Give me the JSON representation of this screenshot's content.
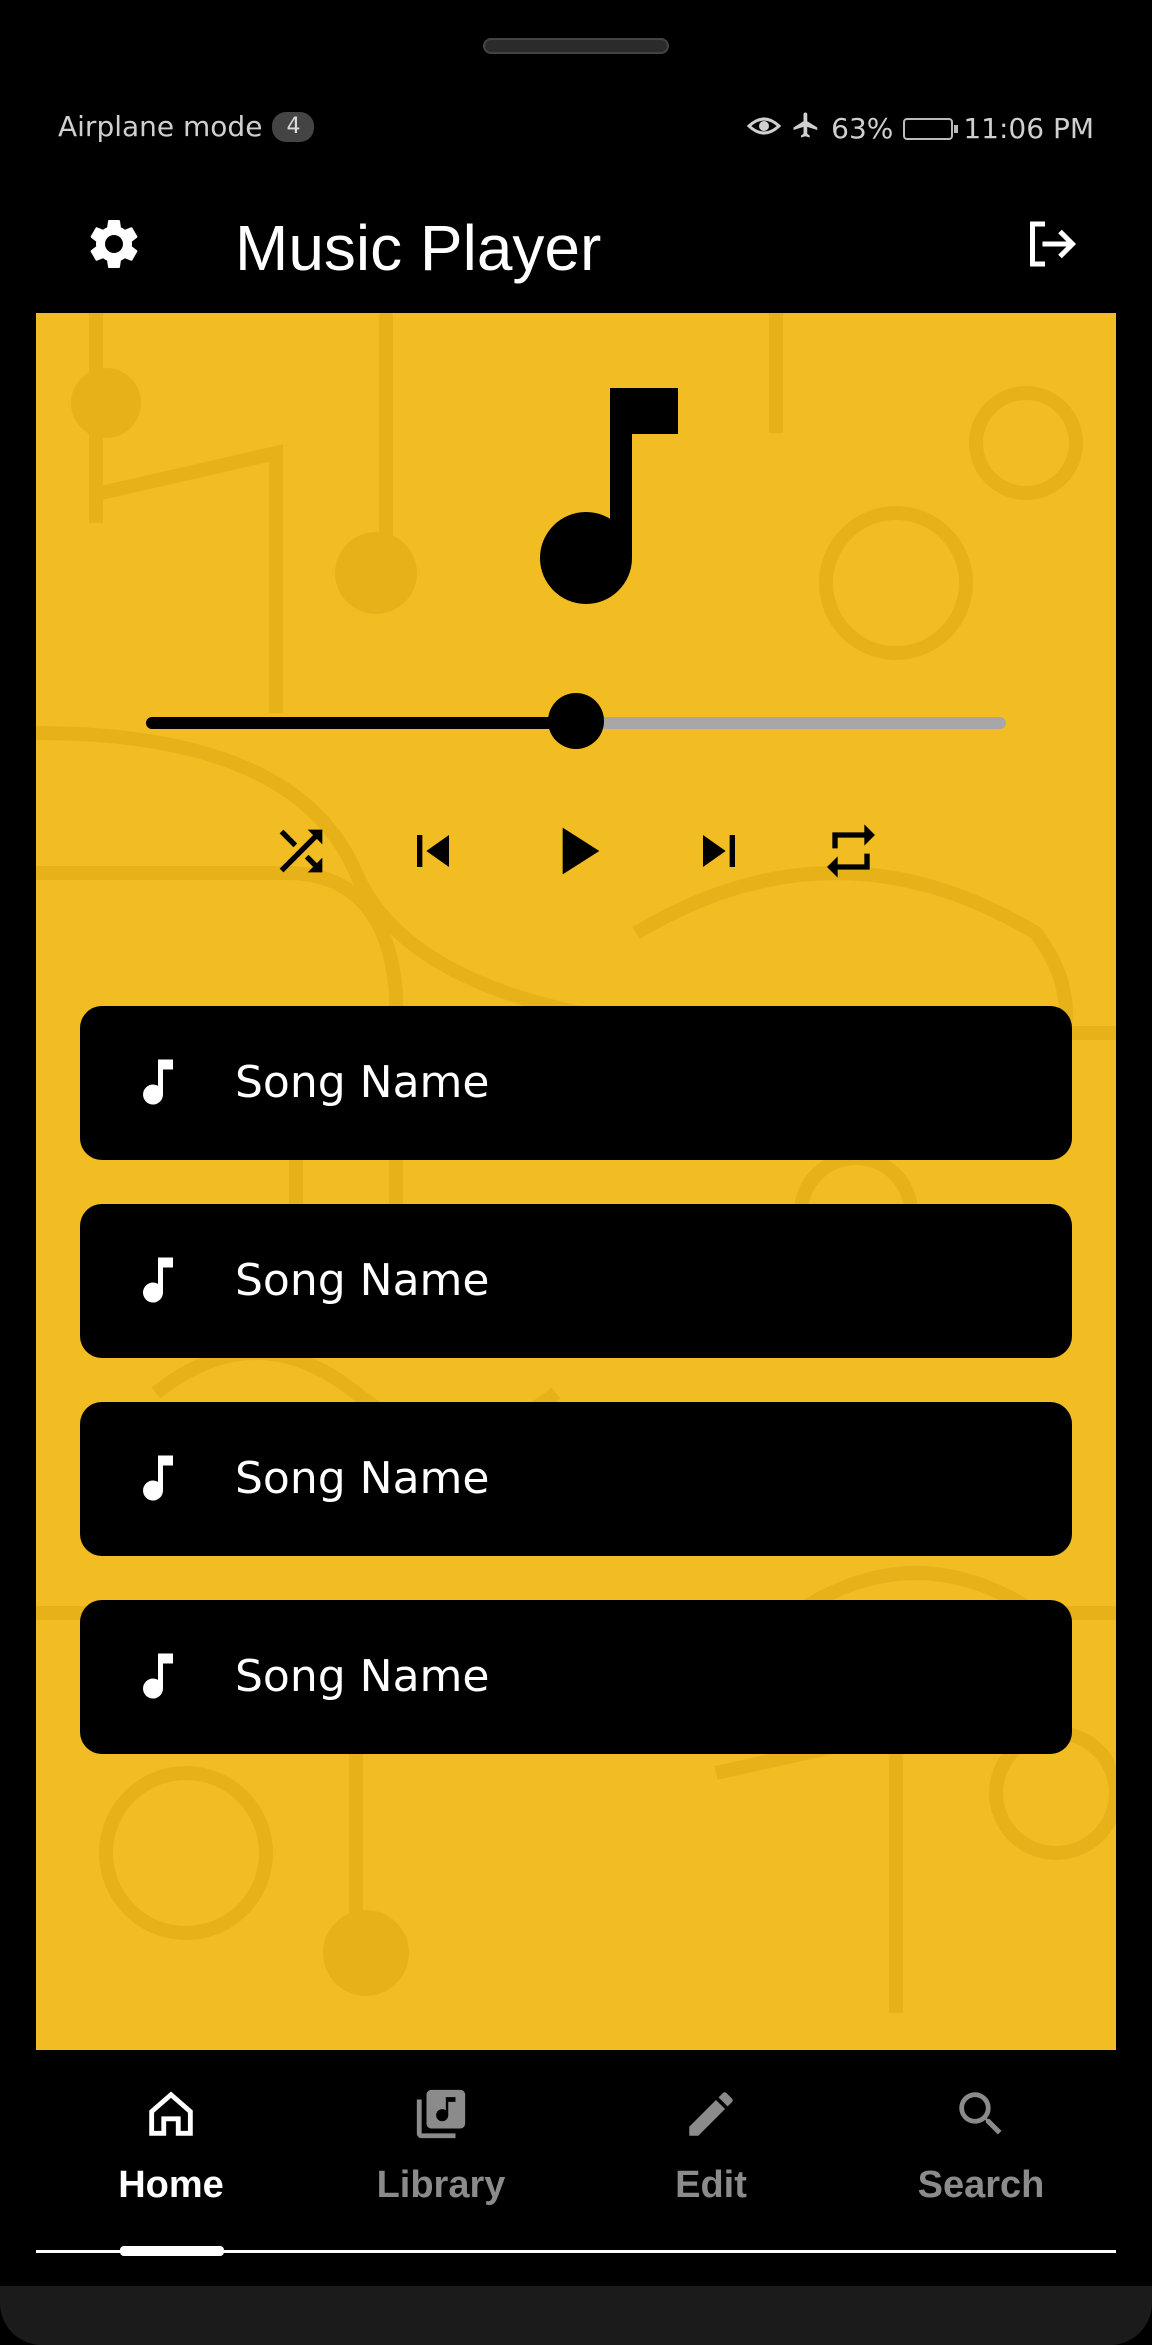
{
  "status_bar": {
    "airplane_mode": "Airplane mode",
    "notification_count": "4",
    "battery": "63%",
    "time": "11:06 PM"
  },
  "app_bar": {
    "title": "Music Player",
    "settings_icon": "gear-icon",
    "logout_icon": "logout-icon"
  },
  "player": {
    "progress_fraction": 0.5,
    "controls": [
      "shuffle-icon",
      "skip-previous-icon",
      "play-icon",
      "skip-next-icon",
      "repeat-icon"
    ]
  },
  "songs": [
    {
      "name": "Song Name"
    },
    {
      "name": "Song Name"
    },
    {
      "name": "Song Name"
    },
    {
      "name": "Song Name"
    }
  ],
  "bottom_nav": {
    "items": [
      {
        "label": "Home",
        "icon": "home-icon",
        "active": true
      },
      {
        "label": "Library",
        "icon": "library-icon",
        "active": false
      },
      {
        "label": "Edit",
        "icon": "edit-icon",
        "active": false
      },
      {
        "label": "Search",
        "icon": "search-icon",
        "active": false
      }
    ]
  },
  "colors": {
    "background": "#000000",
    "accent": "#f2bd22",
    "active_text": "#ffffff",
    "inactive_text": "#8b8b8b",
    "track_inactive": "#a7a7a7"
  }
}
